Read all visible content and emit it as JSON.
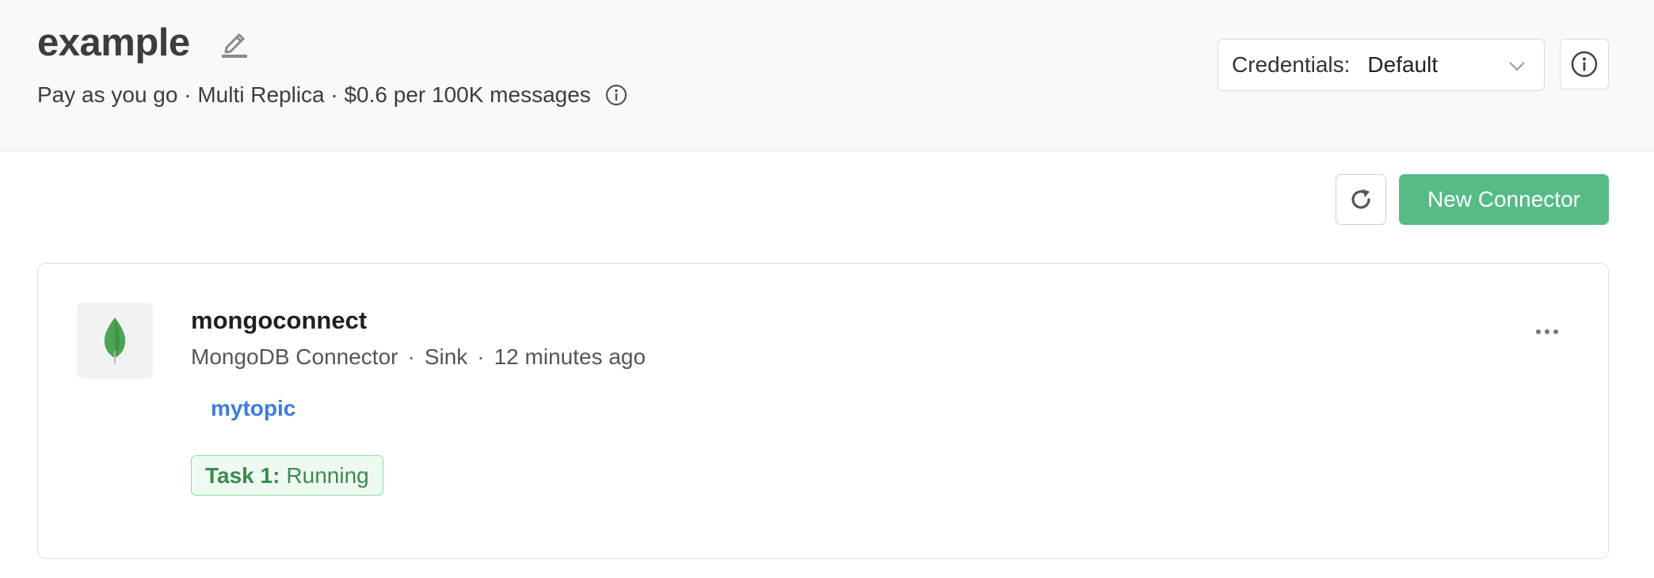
{
  "header": {
    "title": "example",
    "subtitle": "Pay as you go · Multi Replica · $0.6 per 100K messages"
  },
  "credentials": {
    "label": "Credentials:",
    "value": "Default"
  },
  "toolbar": {
    "new_connector_label": "New Connector"
  },
  "connector": {
    "name": "mongoconnect",
    "type": "MongoDB Connector",
    "mode": "Sink",
    "created": "12 minutes ago",
    "separator": "·",
    "topic": "mytopic",
    "task": {
      "key": "Task 1:",
      "status": "Running"
    }
  },
  "icons": {
    "edit": "pencil-icon",
    "info": "info-icon",
    "chevron": "chevron-down-icon",
    "refresh": "refresh-icon",
    "more": "more-horizontal-icon",
    "logo": "mongodb-leaf-icon"
  },
  "colors": {
    "accent_green": "#57bb86",
    "link_blue": "#3c7be0",
    "badge_green_text": "#3b8a4f",
    "badge_green_bg": "#eefaf1",
    "header_bg": "#f9f9f9"
  }
}
